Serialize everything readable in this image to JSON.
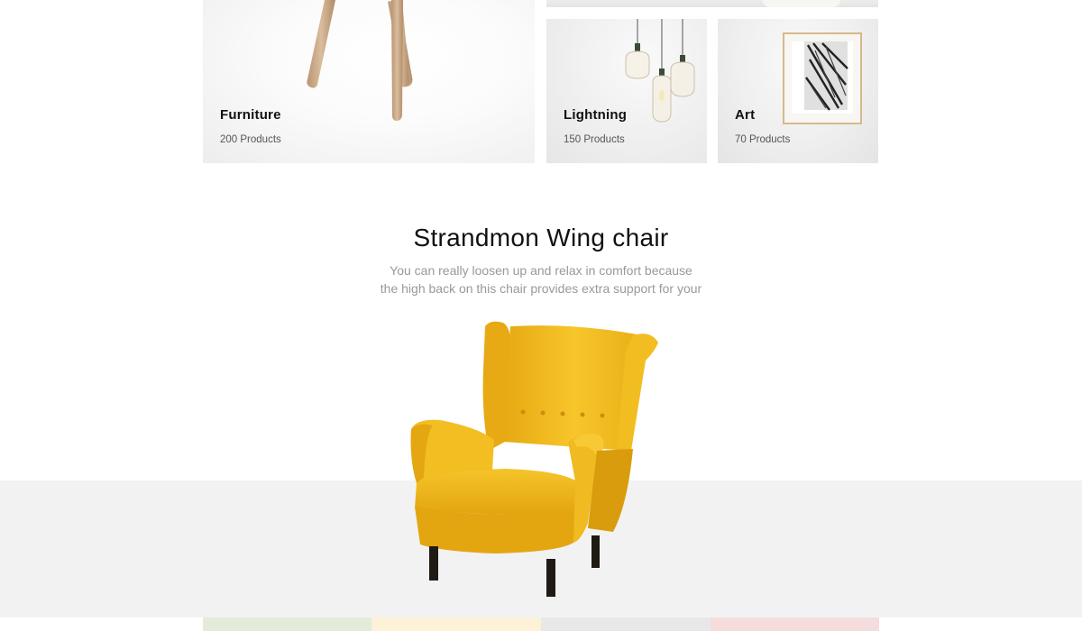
{
  "categories": {
    "furniture": {
      "title": "Furniture",
      "count": "200 Products"
    },
    "lightning": {
      "title": "Lightning",
      "count": "150 Products"
    },
    "art": {
      "title": "Art",
      "count": "70 Products"
    }
  },
  "featured": {
    "title": "Strandmon Wing chair",
    "description_line1": "You can really loosen up and relax in comfort because",
    "description_line2": "the high back on this chair provides extra support for your",
    "product_color": "#f2bd21"
  },
  "strips": {
    "colors": [
      "#e3ecd9",
      "#fdf1d8",
      "#e8e8e8",
      "#f5dcdd"
    ]
  }
}
